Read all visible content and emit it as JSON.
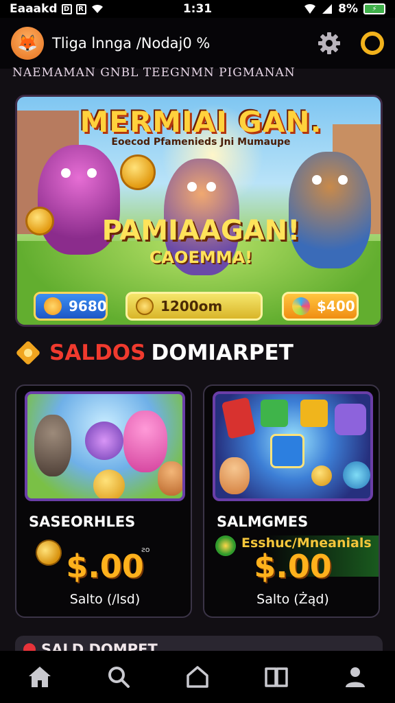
{
  "status_bar": {
    "carrier": "Eaaakd",
    "time": "1:31",
    "battery_pct": "8%"
  },
  "header": {
    "title": "Tliga lnnga /Nodaj0  %",
    "avatar_icon": "fox-avatar-icon",
    "settings_icon": "gear-icon",
    "ring_icon": "ring-icon"
  },
  "subheader": "NAEMAMAN GNBL TEEGNMN PIGMANAN",
  "banner": {
    "headline": "MERMIAI GAN.",
    "tagline": "Eoecod Pfamenieds Jni Mumaupe",
    "mid_title": "PAMIAAGAN!",
    "mid_sub": "CAOEMMA!",
    "chips": [
      {
        "icon": "heart-icon",
        "value": "9680"
      },
      {
        "icon": "coin-icon",
        "value": "1200om"
      },
      {
        "icon": "gem-icon",
        "value": "$400"
      }
    ]
  },
  "section": {
    "title_red": "SALDOS",
    "title_white": "DOMIARPET"
  },
  "cards": [
    {
      "name": "SASEORHLES",
      "amount": "$.00",
      "note": "ƨo",
      "sub": "Salto (/lsd)"
    },
    {
      "name": "SALMGMES",
      "promo": "Esshuc/Mneanials",
      "amount": "$.00",
      "sub": "Salto (Żąd)"
    }
  ],
  "peek": {
    "title": "SALD DOMPET"
  },
  "nav": [
    {
      "icon": "home-icon"
    },
    {
      "icon": "search-icon"
    },
    {
      "icon": "house-outline-icon"
    },
    {
      "icon": "book-icon"
    },
    {
      "icon": "profile-icon"
    }
  ],
  "colors": {
    "accent_gold": "#f2b21c",
    "accent_red": "#f03a2e",
    "card_border": "#6a3ea7",
    "background": "#120f14"
  }
}
